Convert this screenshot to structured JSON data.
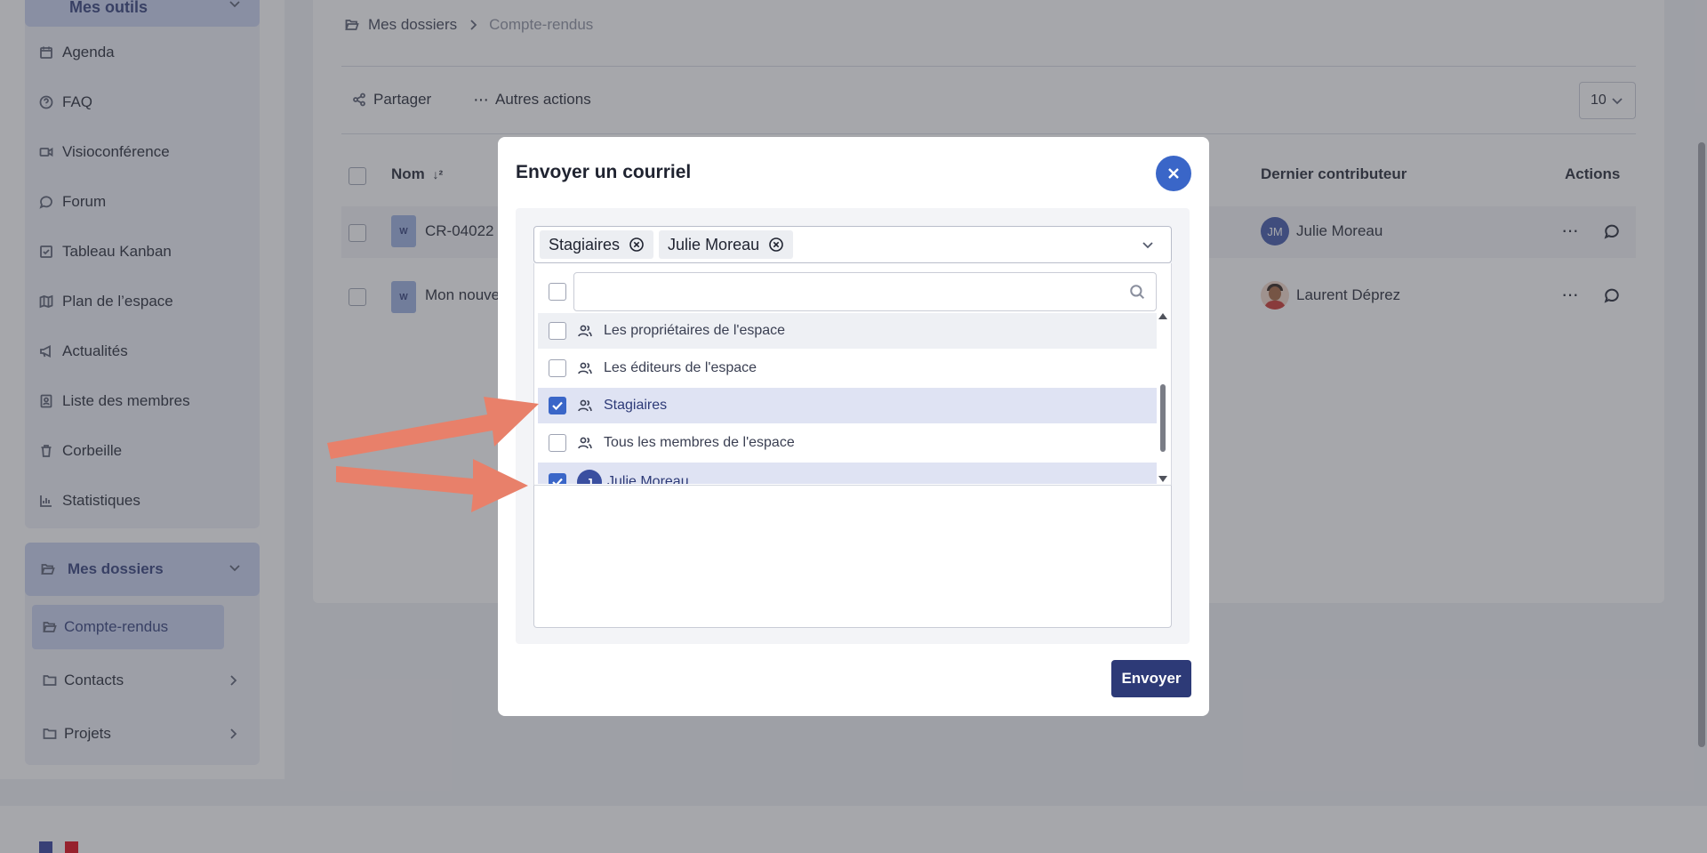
{
  "sidebar": {
    "tools_header": "Mes outils",
    "items": [
      {
        "label": "Agenda",
        "icon": "calendar-icon"
      },
      {
        "label": "FAQ",
        "icon": "help-circle-icon"
      },
      {
        "label": "Visioconférence",
        "icon": "video-icon"
      },
      {
        "label": "Forum",
        "icon": "chat-icon"
      },
      {
        "label": "Tableau Kanban",
        "icon": "checkbox-icon"
      },
      {
        "label": "Plan de l’espace",
        "icon": "map-icon"
      },
      {
        "label": "Actualités",
        "icon": "megaphone-icon"
      },
      {
        "label": "Liste des membres",
        "icon": "contact-card-icon"
      },
      {
        "label": "Corbeille",
        "icon": "trash-icon"
      },
      {
        "label": "Statistiques",
        "icon": "bar-chart-icon"
      }
    ],
    "folders_header": "Mes dossiers",
    "folders": [
      {
        "label": "Compte-rendus",
        "active": true
      },
      {
        "label": "Contacts",
        "active": false
      },
      {
        "label": "Projets",
        "active": false
      }
    ]
  },
  "breadcrumb": {
    "root": "Mes dossiers",
    "current": "Compte-rendus"
  },
  "toolbar": {
    "share_label": "Partager",
    "more_label": "Autres actions",
    "page_size": "10"
  },
  "table": {
    "col_name": "Nom",
    "col_contributor": "Dernier contributeur",
    "col_actions": "Actions",
    "rows": [
      {
        "file_type": "W",
        "name": "CR-04022",
        "contributor": "Julie Moreau",
        "contributor_initials": "JM"
      },
      {
        "file_type": "W",
        "name": "Mon nouve",
        "contributor": "Laurent Déprez"
      }
    ]
  },
  "modal": {
    "title": "Envoyer un courriel",
    "recipients": [
      "Stagiaires",
      "Julie Moreau"
    ],
    "search_value": "",
    "options": [
      {
        "label": "Les propriétaires de l'espace",
        "type": "group",
        "checked": false
      },
      {
        "label": "Les éditeurs de l'espace",
        "type": "group",
        "checked": false
      },
      {
        "label": "Stagiaires",
        "type": "group",
        "checked": true
      },
      {
        "label": "Tous les membres de l'espace",
        "type": "group",
        "checked": false
      },
      {
        "label": "Julie Moreau",
        "type": "user",
        "initial": "J",
        "checked": true
      }
    ],
    "send_label": "Envoyer"
  },
  "colors": {
    "primary": "#2d3a77",
    "accent": "#3a66c8",
    "annotation_arrow": "#e8806a"
  }
}
